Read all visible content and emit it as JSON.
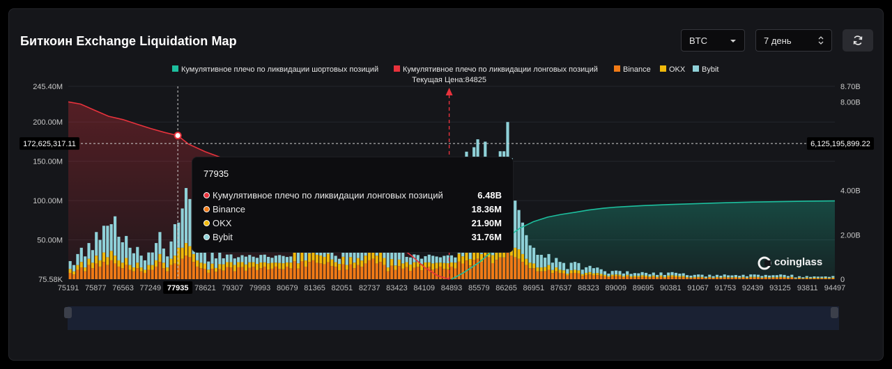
{
  "header": {
    "title": "Биткоин Exchange Liquidation Map",
    "coin_select": "BTC",
    "range_select": "7 день"
  },
  "icons": {
    "refresh": "refresh-icon",
    "coin_caret": "chevron-down-icon",
    "range_caret": "updown-icon",
    "logo": "coinglass-logo-icon"
  },
  "brand": "coinglass",
  "colors": {
    "short_cum": "#1dbf9e",
    "long_cum": "#e8323c",
    "binance": "#f07a16",
    "okx": "#f0b90b",
    "bybit": "#8fd1d8",
    "background": "#15161a"
  },
  "chart_data": {
    "type": "bar",
    "legend": [
      "Кумулятивное плечо по ликвидации шортовых позиций",
      "Кумулятивное плечо по ликвидации лонговых позиций",
      "Binance",
      "OKX",
      "Bybit"
    ],
    "legend_position": "top",
    "current_price_label": "Текущая Цена:84825",
    "current_price": 84825,
    "x_ticks": [
      "75191",
      "75877",
      "76563",
      "77249",
      "77935",
      "78621",
      "79307",
      "79993",
      "80679",
      "81365",
      "82051",
      "82737",
      "83423",
      "84109",
      "84893",
      "85579",
      "86265",
      "86951",
      "87637",
      "88323",
      "89009",
      "89695",
      "90381",
      "91067",
      "91753",
      "92439",
      "93125",
      "93811",
      "94497"
    ],
    "x_range": [
      75191,
      94497
    ],
    "y_left_ticks": [
      "245.40M",
      "200.00M",
      "150.00M",
      "100.00M",
      "50.00M",
      "75.58K"
    ],
    "y_left_range": [
      0,
      245.4
    ],
    "y_right_ticks": [
      "8.70B",
      "8.00B",
      "4.00B",
      "2.00B",
      "0"
    ],
    "y_right_range": [
      0,
      8.7
    ],
    "crosshair": {
      "x": 77935,
      "left_value": "172,625,317.11",
      "right_value": "6,125,195,899.22"
    },
    "series": [
      {
        "name": "Кумулятивное плечо по ликвидации лонговых позиций",
        "axis": "right",
        "x": [
          75191,
          75500,
          75877,
          76200,
          76563,
          76900,
          77249,
          77600,
          77935,
          78200,
          78621,
          79000,
          79307,
          79700,
          79993,
          80400,
          80679,
          81000,
          81365,
          81700,
          82051,
          82400,
          82737,
          83100,
          83423,
          83800,
          84109,
          84500,
          84825
        ],
        "values": [
          8.0,
          7.9,
          7.6,
          7.35,
          7.2,
          7.0,
          6.8,
          6.62,
          6.48,
          6.1,
          5.75,
          5.5,
          5.3,
          5.05,
          4.85,
          4.55,
          4.3,
          4.0,
          3.7,
          3.4,
          3.05,
          2.7,
          2.35,
          1.95,
          1.55,
          1.05,
          0.55,
          0.15,
          0.0
        ]
      },
      {
        "name": "Кумулятивное плечо по ликвидации шортовых позиций",
        "axis": "right",
        "x": [
          84893,
          85200,
          85579,
          85900,
          86265,
          86600,
          86951,
          87300,
          87637,
          88000,
          88323,
          88700,
          89009,
          89695,
          90381,
          91067,
          91753,
          92439,
          93125,
          93811,
          94497
        ],
        "values": [
          0.0,
          0.3,
          0.75,
          1.25,
          1.85,
          2.3,
          2.6,
          2.8,
          2.92,
          3.02,
          3.12,
          3.2,
          3.25,
          3.32,
          3.37,
          3.41,
          3.45,
          3.48,
          3.5,
          3.52,
          3.53
        ]
      }
    ],
    "tooltip": {
      "title": "77935",
      "rows": [
        {
          "label": "Кумулятивное плечо по ликвидации лонговых позиций",
          "value": "6.48B",
          "color": "#e8323c"
        },
        {
          "label": "Binance",
          "value": "18.36M",
          "color": "#f07a16"
        },
        {
          "label": "OKX",
          "value": "21.90M",
          "color": "#f0b90b"
        },
        {
          "label": "Bybit",
          "value": "31.76M",
          "color": "#8fd1d8"
        }
      ]
    },
    "bars_note_values_M": [
      [
        75191,
        8,
        5,
        10
      ],
      [
        75300,
        6,
        4,
        8
      ],
      [
        75400,
        12,
        6,
        14
      ],
      [
        75500,
        15,
        7,
        18
      ],
      [
        75600,
        10,
        5,
        14
      ],
      [
        75700,
        18,
        8,
        20
      ],
      [
        75800,
        14,
        7,
        16
      ],
      [
        75877,
        20,
        10,
        30
      ],
      [
        75950,
        16,
        8,
        26
      ],
      [
        76050,
        22,
        12,
        34
      ],
      [
        76150,
        18,
        10,
        40
      ],
      [
        76250,
        24,
        12,
        34
      ],
      [
        76350,
        20,
        10,
        50
      ],
      [
        76450,
        16,
        8,
        30
      ],
      [
        76563,
        14,
        7,
        26
      ],
      [
        76650,
        18,
        9,
        28
      ],
      [
        76750,
        12,
        6,
        22
      ],
      [
        76850,
        10,
        5,
        18
      ],
      [
        76950,
        14,
        7,
        20
      ],
      [
        77050,
        10,
        5,
        15
      ],
      [
        77150,
        8,
        4,
        12
      ],
      [
        77249,
        12,
        6,
        16
      ],
      [
        77350,
        16,
        8,
        22
      ],
      [
        77450,
        22,
        10,
        28
      ],
      [
        77550,
        14,
        7,
        18
      ],
      [
        77650,
        10,
        5,
        14
      ],
      [
        77750,
        18,
        8,
        22
      ],
      [
        77850,
        20,
        10,
        40
      ],
      [
        77935,
        18,
        22,
        32
      ],
      [
        78050,
        26,
        14,
        50
      ],
      [
        78150,
        30,
        16,
        70
      ],
      [
        78250,
        28,
        14,
        60
      ],
      [
        78350,
        22,
        10,
        40
      ],
      [
        78450,
        16,
        8,
        20
      ],
      [
        78550,
        14,
        7,
        18
      ],
      [
        81365,
        24,
        12,
        70
      ],
      [
        82600,
        20,
        10,
        70
      ],
      [
        82737,
        24,
        12,
        60
      ],
      [
        82800,
        26,
        14,
        80
      ],
      [
        82900,
        20,
        10,
        72
      ],
      [
        83000,
        22,
        12,
        90
      ],
      [
        83100,
        18,
        9,
        60
      ],
      [
        85579,
        26,
        12,
        140
      ],
      [
        85650,
        22,
        10,
        100
      ],
      [
        85750,
        30,
        15,
        130
      ],
      [
        85850,
        28,
        14,
        100
      ],
      [
        86265,
        34,
        16,
        150
      ],
      [
        86350,
        30,
        14,
        110
      ],
      [
        86450,
        28,
        12,
        60
      ],
      [
        86550,
        26,
        12,
        50
      ],
      [
        86650,
        22,
        10,
        40
      ],
      [
        86751,
        18,
        8,
        30
      ],
      [
        86851,
        14,
        7,
        22
      ],
      [
        86951,
        14,
        6,
        20
      ],
      [
        87100,
        10,
        5,
        16
      ],
      [
        87300,
        12,
        6,
        14
      ],
      [
        87500,
        10,
        5,
        12
      ],
      [
        87637,
        8,
        4,
        10
      ],
      [
        88000,
        8,
        4,
        10
      ],
      [
        88323,
        6,
        3,
        8
      ],
      [
        89009,
        4,
        2,
        5
      ],
      [
        89695,
        3,
        2,
        4
      ],
      [
        90381,
        3,
        2,
        4
      ],
      [
        91067,
        2,
        1,
        3
      ],
      [
        91753,
        2,
        1,
        3
      ],
      [
        92439,
        2,
        1,
        3
      ],
      [
        93125,
        2,
        1,
        3
      ],
      [
        93811,
        1,
        1,
        2
      ],
      [
        94497,
        1,
        1,
        2
      ]
    ]
  }
}
